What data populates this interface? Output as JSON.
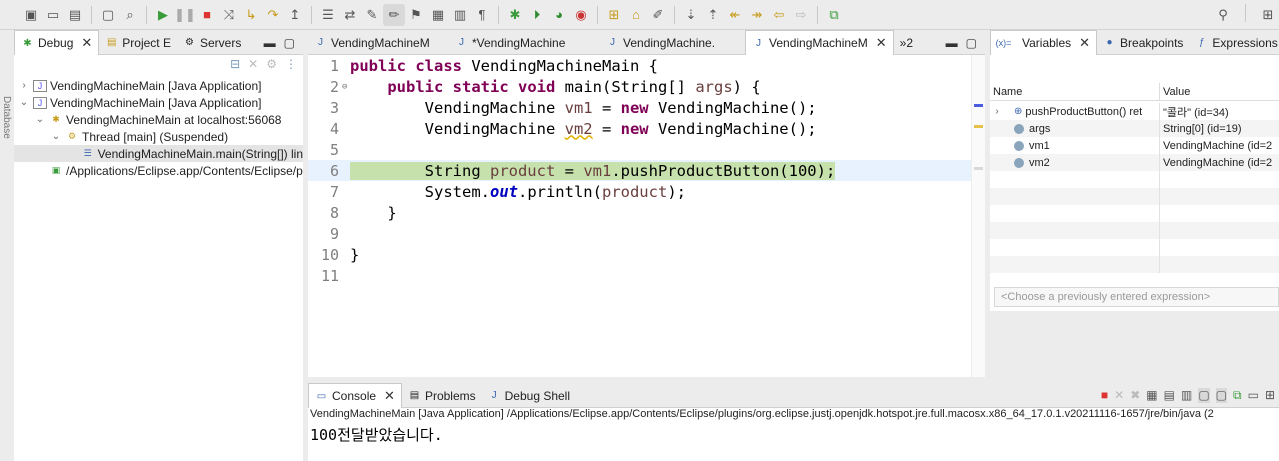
{
  "debug_view": {
    "tabs": [
      {
        "label": "Debug",
        "active": true
      },
      {
        "label": "Project E",
        "active": false
      },
      {
        "label": "Servers",
        "active": false
      }
    ],
    "tree": [
      {
        "indent": 0,
        "arrow": "›",
        "label": "VendingMachineMain [Java Application]",
        "selected": false
      },
      {
        "indent": 0,
        "arrow": "⌄",
        "label": "VendingMachineMain [Java Application]",
        "selected": false
      },
      {
        "indent": 1,
        "arrow": "⌄",
        "label": "VendingMachineMain at localhost:56068",
        "selected": false
      },
      {
        "indent": 2,
        "arrow": "⌄",
        "label": "Thread [main] (Suspended)",
        "selected": false
      },
      {
        "indent": 3,
        "arrow": "",
        "label": "VendingMachineMain.main(String[]) lin",
        "selected": true
      },
      {
        "indent": 1,
        "arrow": "",
        "label": "/Applications/Eclipse.app/Contents/Eclipse/p",
        "selected": false
      }
    ]
  },
  "side_label": "Database",
  "editor": {
    "tabs": [
      {
        "label": "VendingMachineM",
        "active": false
      },
      {
        "label": "*VendingMachine",
        "active": false
      },
      {
        "label": "VendingMachine.",
        "active": false
      },
      {
        "label": "VendingMachineM",
        "active": true
      }
    ],
    "overflow_label": "»2",
    "lines": [
      {
        "n": "1",
        "text": "public class VendingMachineMain {"
      },
      {
        "n": "2",
        "text": "    public static void main(String[] args) {"
      },
      {
        "n": "3",
        "text": "        VendingMachine vm1 = new VendingMachine();"
      },
      {
        "n": "4",
        "text": "        VendingMachine vm2 = new VendingMachine();"
      },
      {
        "n": "5",
        "text": ""
      },
      {
        "n": "6",
        "text": "        String product = vm1.pushProductButton(100);"
      },
      {
        "n": "7",
        "text": "        System.out.println(product);"
      },
      {
        "n": "8",
        "text": "    }"
      },
      {
        "n": "9",
        "text": ""
      },
      {
        "n": "10",
        "text": "}"
      },
      {
        "n": "11",
        "text": ""
      }
    ]
  },
  "variables_view": {
    "tabs": [
      {
        "label": "Variables",
        "active": true
      },
      {
        "label": "Breakpoints",
        "active": false
      },
      {
        "label": "Expressions",
        "active": false
      }
    ],
    "columns": [
      "Name",
      "Value"
    ],
    "rows": [
      {
        "name": "pushProductButton() ret",
        "value": "\"콜라\" (id=34)"
      },
      {
        "name": "args",
        "value": "String[0]  (id=19)"
      },
      {
        "name": "vm1",
        "value": "VendingMachine  (id=2"
      },
      {
        "name": "vm2",
        "value": "VendingMachine  (id=2"
      }
    ],
    "expression_placeholder": "<Choose a previously entered expression>"
  },
  "console_view": {
    "tabs": [
      {
        "label": "Console",
        "active": true
      },
      {
        "label": "Problems",
        "active": false
      },
      {
        "label": "Debug Shell",
        "active": false
      }
    ],
    "path": "VendingMachineMain [Java Application] /Applications/Eclipse.app/Contents/Eclipse/plugins/org.eclipse.justj.openjdk.hotspot.jre.full.macosx.x86_64_17.0.1.v20211116-1657/jre/bin/java  (2",
    "output": "100전달받았습니다."
  }
}
